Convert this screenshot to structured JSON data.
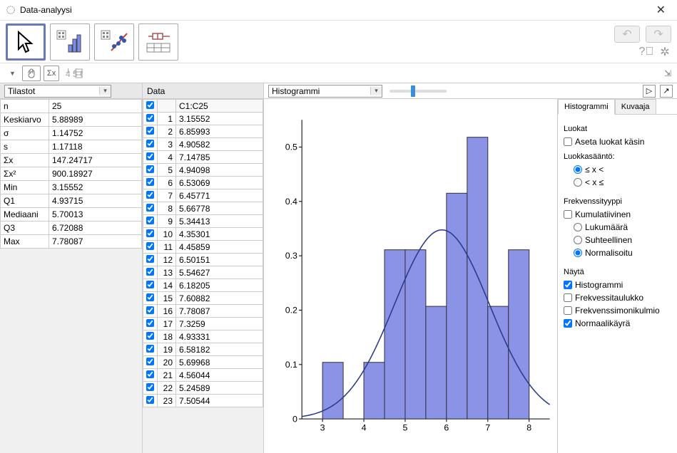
{
  "window": {
    "title": "Data-analyysi"
  },
  "stats_panel": {
    "title": "Tilastot",
    "rows": [
      {
        "label": "n",
        "value": "25"
      },
      {
        "label": "Keskiarvo",
        "value": "5.88989"
      },
      {
        "label": "σ",
        "value": "1.14752"
      },
      {
        "label": "s",
        "value": "1.17118"
      },
      {
        "label": "Σx",
        "value": "147.24717"
      },
      {
        "label": "Σx²",
        "value": "900.18927"
      },
      {
        "label": "Min",
        "value": "3.15552"
      },
      {
        "label": "Q1",
        "value": "4.93715"
      },
      {
        "label": "Mediaani",
        "value": "5.70013"
      },
      {
        "label": "Q3",
        "value": "6.72088"
      },
      {
        "label": "Max",
        "value": "7.78087"
      }
    ]
  },
  "data_panel": {
    "title": "Data",
    "col_header": "C1:C25",
    "rows": [
      {
        "i": "1",
        "v": "3.15552"
      },
      {
        "i": "2",
        "v": "6.85993"
      },
      {
        "i": "3",
        "v": "4.90582"
      },
      {
        "i": "4",
        "v": "7.14785"
      },
      {
        "i": "5",
        "v": "4.94098"
      },
      {
        "i": "6",
        "v": "6.53069"
      },
      {
        "i": "7",
        "v": "6.45771"
      },
      {
        "i": "8",
        "v": "5.66778"
      },
      {
        "i": "9",
        "v": "5.34413"
      },
      {
        "i": "10",
        "v": "4.35301"
      },
      {
        "i": "11",
        "v": "4.45859"
      },
      {
        "i": "12",
        "v": "6.50151"
      },
      {
        "i": "13",
        "v": "5.54627"
      },
      {
        "i": "14",
        "v": "6.18205"
      },
      {
        "i": "15",
        "v": "7.60882"
      },
      {
        "i": "16",
        "v": "7.78087"
      },
      {
        "i": "17",
        "v": "7.3259"
      },
      {
        "i": "18",
        "v": "4.93331"
      },
      {
        "i": "19",
        "v": "6.58182"
      },
      {
        "i": "20",
        "v": "5.69968"
      },
      {
        "i": "21",
        "v": "4.56044"
      },
      {
        "i": "22",
        "v": "5.24589"
      },
      {
        "i": "23",
        "v": "7.50544"
      }
    ]
  },
  "chart": {
    "type_label": "Histogrammi",
    "tabs": {
      "histogram": "Histogrammi",
      "plot": "Kuvaaja"
    },
    "options": {
      "luokat_title": "Luokat",
      "manual_classes": "Aseta luokat käsin",
      "rule_title": "Luokkasääntö:",
      "rule1": "≤ x <",
      "rule2": "< x ≤",
      "freqtype_title": "Frekvenssityyppi",
      "cumulative": "Kumulatiivinen",
      "count": "Lukumäärä",
      "relative": "Suhteellinen",
      "normalized": "Normalisoitu",
      "show_title": "Näytä",
      "show_hist": "Histogrammi",
      "show_freqtable": "Frekvessitaulukko",
      "show_freqpoly": "Frekvenssimonikulmio",
      "show_normal": "Normaalikäyrä"
    }
  },
  "chart_data": {
    "type": "bar",
    "title": "",
    "xlabel": "",
    "ylabel": "",
    "xlim": [
      2.5,
      8.5
    ],
    "ylim": [
      0,
      0.55
    ],
    "x_ticks": [
      3,
      4,
      5,
      6,
      7,
      8
    ],
    "y_ticks": [
      0,
      0.1,
      0.2,
      0.3,
      0.4,
      0.5
    ],
    "bin_width": 0.5,
    "bins": [
      {
        "x0": 3.0,
        "x1": 3.5,
        "h": 0.104
      },
      {
        "x0": 4.0,
        "x1": 4.5,
        "h": 0.104
      },
      {
        "x0": 4.5,
        "x1": 5.0,
        "h": 0.311
      },
      {
        "x0": 5.0,
        "x1": 5.5,
        "h": 0.311
      },
      {
        "x0": 5.5,
        "x1": 6.0,
        "h": 0.207
      },
      {
        "x0": 6.0,
        "x1": 6.5,
        "h": 0.415
      },
      {
        "x0": 6.5,
        "x1": 7.0,
        "h": 0.518
      },
      {
        "x0": 7.0,
        "x1": 7.5,
        "h": 0.207
      },
      {
        "x0": 7.5,
        "x1": 8.0,
        "h": 0.311
      }
    ],
    "normal_curve": {
      "mean": 5.88989,
      "sigma": 1.14752
    }
  }
}
